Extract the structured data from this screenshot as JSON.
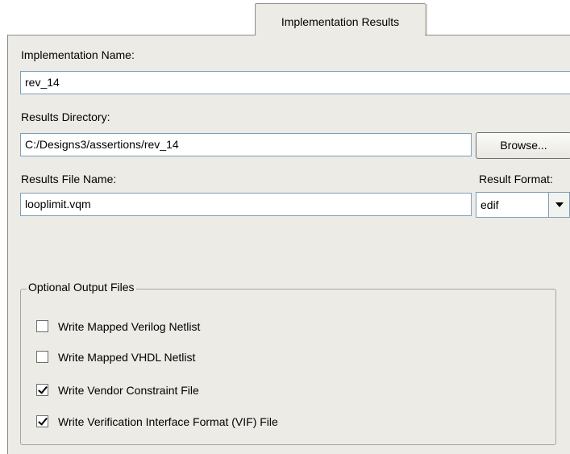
{
  "tab": {
    "label": "Implementation Results"
  },
  "implementation_name": {
    "label": "Implementation Name:",
    "value": "rev_14"
  },
  "results_directory": {
    "label": "Results Directory:",
    "value": "C:/Designs3/assertions/rev_14",
    "browse_label": "Browse..."
  },
  "results_file_name": {
    "label": "Results File Name:",
    "value": "looplimit.vqm"
  },
  "result_format": {
    "label": "Result Format:",
    "selected": "edif"
  },
  "optional_output_files": {
    "legend": "Optional Output Files",
    "items": [
      {
        "label": "Write Mapped Verilog Netlist",
        "checked": false
      },
      {
        "label": "Write Mapped VHDL Netlist",
        "checked": false
      },
      {
        "label": "Write Vendor Constraint File",
        "checked": true
      },
      {
        "label": "Write Verification Interface Format (VIF) File",
        "checked": true
      }
    ]
  }
}
